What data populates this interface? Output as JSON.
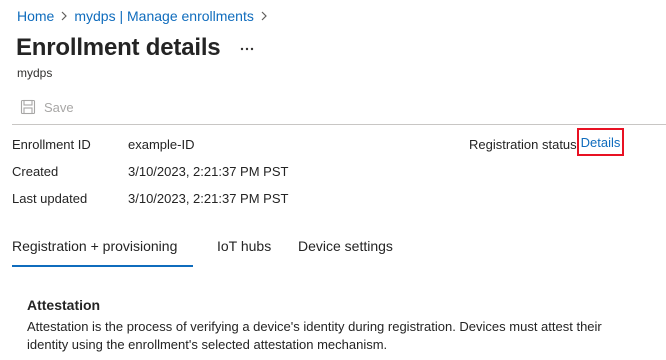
{
  "breadcrumb": {
    "items": [
      "Home",
      "mydps | Manage enrollments"
    ]
  },
  "header": {
    "title": "Enrollment details",
    "more_label": "...",
    "subtitle": "mydps"
  },
  "toolbar": {
    "save_label": "Save",
    "save_icon": "save-icon"
  },
  "details": {
    "enrollment_id_label": "Enrollment ID",
    "enrollment_id_value": "example-ID",
    "created_label": "Created",
    "created_value": "3/10/2023, 2:21:37 PM PST",
    "last_updated_label": "Last updated",
    "last_updated_value": "3/10/2023, 2:21:37 PM PST",
    "registration_status_label": "Registration status",
    "registration_status_link": "Details"
  },
  "tabs": [
    {
      "label": "Registration + provisioning",
      "selected": true
    },
    {
      "label": "IoT hubs",
      "selected": false
    },
    {
      "label": "Device settings",
      "selected": false
    }
  ],
  "attestation": {
    "heading": "Attestation",
    "body": "Attestation is the process of verifying a device's identity during registration. Devices must attest their identity using the enrollment's selected attestation mechanism."
  },
  "colors": {
    "link": "#0f6cbd",
    "highlight_box": "#e81123",
    "tab_underline": "#0f6cbd"
  }
}
